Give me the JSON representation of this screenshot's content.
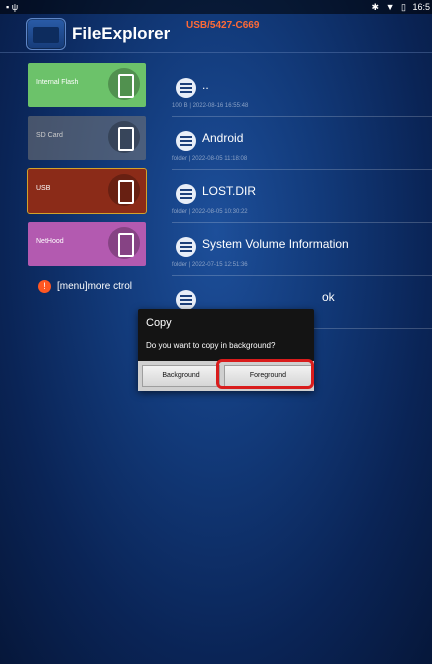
{
  "status_bar": {
    "time": "16:5"
  },
  "app": {
    "title": "FileExplorer",
    "path": "USB/5427-C669"
  },
  "sidebar": {
    "tiles": [
      {
        "label": "Internal Flash"
      },
      {
        "label": "SD Card"
      },
      {
        "label": "USB"
      },
      {
        "label": "NetHood"
      }
    ],
    "menu_hint": "[menu]more ctrol",
    "menu_icon_glyph": "!"
  },
  "files": [
    {
      "name": "..",
      "meta": "100 B | 2022-08-16 16:55:48"
    },
    {
      "name": "Android",
      "meta": "folder | 2022-08-05 11:18:08"
    },
    {
      "name": "LOST.DIR",
      "meta": "folder | 2022-08-05 10:30:22"
    },
    {
      "name": "System Volume Information",
      "meta": "folder | 2022-07-15 12:51:36"
    },
    {
      "name": "ok",
      "meta": ""
    }
  ],
  "dialog": {
    "title": "Copy",
    "message": "Do you want to copy in background?",
    "background_button": "Background",
    "foreground_button": "Foreground"
  },
  "colors": {
    "path_text": "#ff6a36",
    "highlight": "#d91c1c"
  }
}
